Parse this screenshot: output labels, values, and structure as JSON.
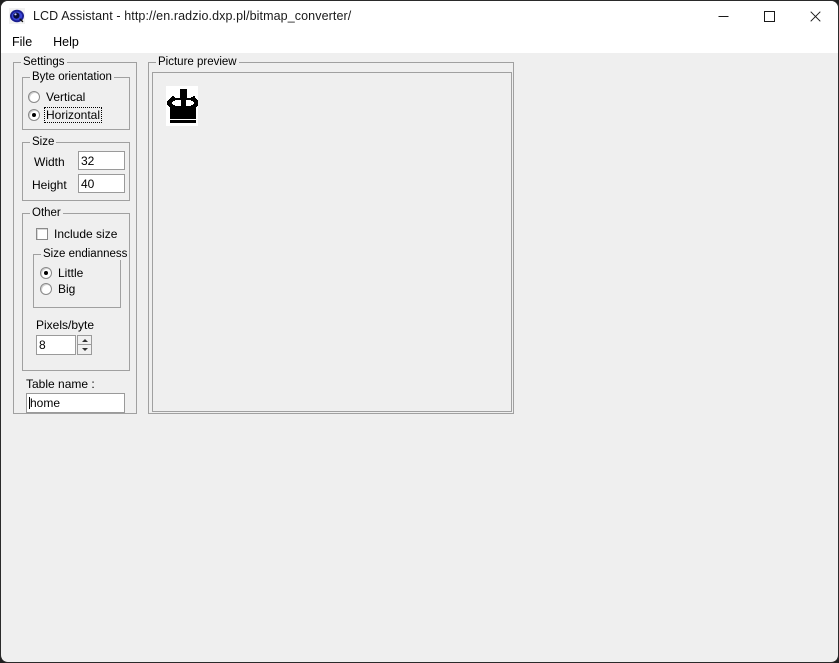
{
  "window": {
    "title": "LCD Assistant -  http://en.radzio.dxp.pl/bitmap_converter/",
    "app_icon": "lcd-assistant-icon",
    "minimize_label": "—",
    "maximize_label": "□",
    "close_label": "✕"
  },
  "menu": {
    "items": [
      {
        "label": "File"
      },
      {
        "label": "Help"
      }
    ]
  },
  "settings": {
    "title": "Settings",
    "byte_orientation": {
      "title": "Byte orientation",
      "options": [
        {
          "label": "Vertical",
          "selected": false,
          "focused": false
        },
        {
          "label": "Horizontal",
          "selected": true,
          "focused": true
        }
      ]
    },
    "size": {
      "title": "Size",
      "width_label": "Width",
      "width_value": "32",
      "height_label": "Height",
      "height_value": "40"
    },
    "other": {
      "title": "Other",
      "include_size_label": "Include size",
      "include_size_checked": false,
      "endianness": {
        "title": "Size endianness",
        "options": [
          {
            "label": "Little",
            "selected": true
          },
          {
            "label": "Big",
            "selected": false
          }
        ]
      },
      "pixels_per_byte_label": "Pixels/byte",
      "pixels_per_byte_value": "8",
      "spin_up_icon": "arrow-up-icon",
      "spin_down_icon": "arrow-down-icon"
    },
    "table_name_label": "Table name :",
    "table_name_value": "home"
  },
  "preview": {
    "title": "Picture preview",
    "bitmap": {
      "name": "home-bitmap",
      "width": 32,
      "height": 40,
      "display_width": 32,
      "display_height": 40,
      "fg_color": "#000000",
      "bg_color": "#ffffff",
      "rows": [
        "00000000000000000000000000000000",
        "00000000000000000000000000000000",
        "00000000000000000000000000000000",
        "00000000000000111111100000000000",
        "00000000000000111111100000000000",
        "00000000000000111111100000000000",
        "00000000000000111111100000000000",
        "00000000000000111111100000000000",
        "00000000000000111111100000000000",
        "00000000000000111111100000000000",
        "00000011000000111111100000011000",
        "00000111100000111111100001111000",
        "00001111111111111111111111111100",
        "00011111111111111111111111111110",
        "00111111100000011111000001111111",
        "01111110000000011111000000011111",
        "01111100000000011111000000001111",
        "01111100000000011111000000001111",
        "01111110000000011111000000011111",
        "00111111100000011111000001111111",
        "00011111111111111111111111111110",
        "00001111111111111111111111111100",
        "00001111111111111111111111111100",
        "00001111111111111111111111111100",
        "00001111111111111111111111111100",
        "00001111111111111111111111111100",
        "00001111111111111111111111111100",
        "00001111111111111111111111111100",
        "00001111111111111111111111111100",
        "00001111111111111111111111111100",
        "00001111111111111111111111111100",
        "00001111111111111111111111111100",
        "00001111111111111111111111111100",
        "00000000000000000000000000000000",
        "00001111111111111111111111111100",
        "00001111111111111111111111111100",
        "00001111111111111111111111111100",
        "00000000000000000000000000000000",
        "00000000000000000000000000000000",
        "00000000000000000000000000000000"
      ]
    }
  }
}
